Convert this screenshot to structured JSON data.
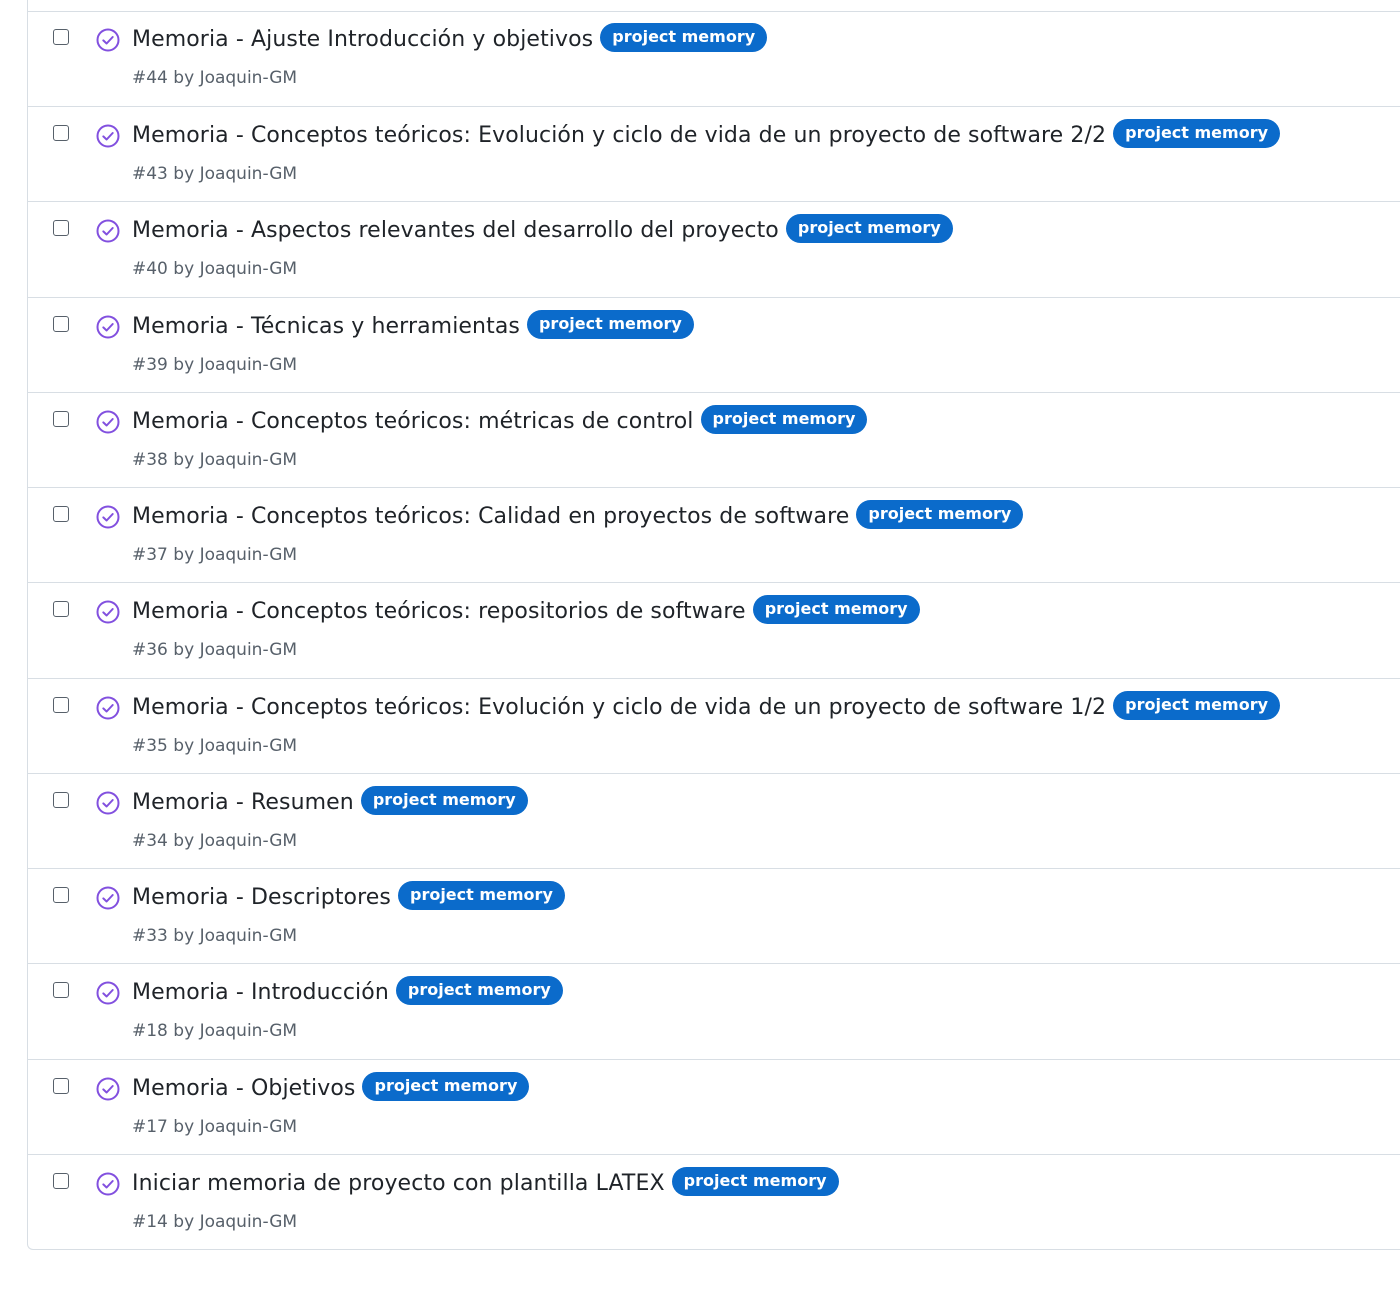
{
  "colors": {
    "label_bg": "#0b6bcb",
    "status_icon": "#8250df",
    "text": "#1f2328",
    "muted": "#57606a",
    "border": "#d8dee4"
  },
  "issues": [
    {
      "title": "Memoria - Ajuste Introducción y objetivos",
      "label": "project memory",
      "number": "#44",
      "by": "by",
      "author": "Joaquin-GM",
      "status_icon": "check-circle-icon"
    },
    {
      "title": "Memoria - Conceptos teóricos: Evolución y ciclo de vida de un proyecto de software 2/2",
      "label": "project memory",
      "number": "#43",
      "by": "by",
      "author": "Joaquin-GM",
      "status_icon": "check-circle-icon"
    },
    {
      "title": "Memoria - Aspectos relevantes del desarrollo del proyecto",
      "label": "project memory",
      "number": "#40",
      "by": "by",
      "author": "Joaquin-GM",
      "status_icon": "check-circle-icon"
    },
    {
      "title": "Memoria - Técnicas y herramientas",
      "label": "project memory",
      "number": "#39",
      "by": "by",
      "author": "Joaquin-GM",
      "status_icon": "check-circle-icon"
    },
    {
      "title": "Memoria - Conceptos teóricos: métricas de control",
      "label": "project memory",
      "number": "#38",
      "by": "by",
      "author": "Joaquin-GM",
      "status_icon": "check-circle-icon"
    },
    {
      "title": "Memoria - Conceptos teóricos: Calidad en proyectos de software",
      "label": "project memory",
      "number": "#37",
      "by": "by",
      "author": "Joaquin-GM",
      "status_icon": "check-circle-icon"
    },
    {
      "title": "Memoria - Conceptos teóricos: repositorios de software",
      "label": "project memory",
      "number": "#36",
      "by": "by",
      "author": "Joaquin-GM",
      "status_icon": "check-circle-icon"
    },
    {
      "title": "Memoria - Conceptos teóricos: Evolución y ciclo de vida de un proyecto de software 1/2",
      "label": "project memory",
      "number": "#35",
      "by": "by",
      "author": "Joaquin-GM",
      "status_icon": "check-circle-icon"
    },
    {
      "title": "Memoria - Resumen",
      "label": "project memory",
      "number": "#34",
      "by": "by",
      "author": "Joaquin-GM",
      "status_icon": "check-circle-icon"
    },
    {
      "title": "Memoria - Descriptores",
      "label": "project memory",
      "number": "#33",
      "by": "by",
      "author": "Joaquin-GM",
      "status_icon": "check-circle-icon"
    },
    {
      "title": "Memoria - Introducción",
      "label": "project memory",
      "number": "#18",
      "by": "by",
      "author": "Joaquin-GM",
      "status_icon": "check-circle-icon"
    },
    {
      "title": "Memoria - Objetivos",
      "label": "project memory",
      "number": "#17",
      "by": "by",
      "author": "Joaquin-GM",
      "status_icon": "check-circle-icon"
    },
    {
      "title": "Iniciar memoria de proyecto con plantilla LATEX",
      "label": "project memory",
      "number": "#14",
      "by": "by",
      "author": "Joaquin-GM",
      "status_icon": "check-circle-icon"
    }
  ]
}
